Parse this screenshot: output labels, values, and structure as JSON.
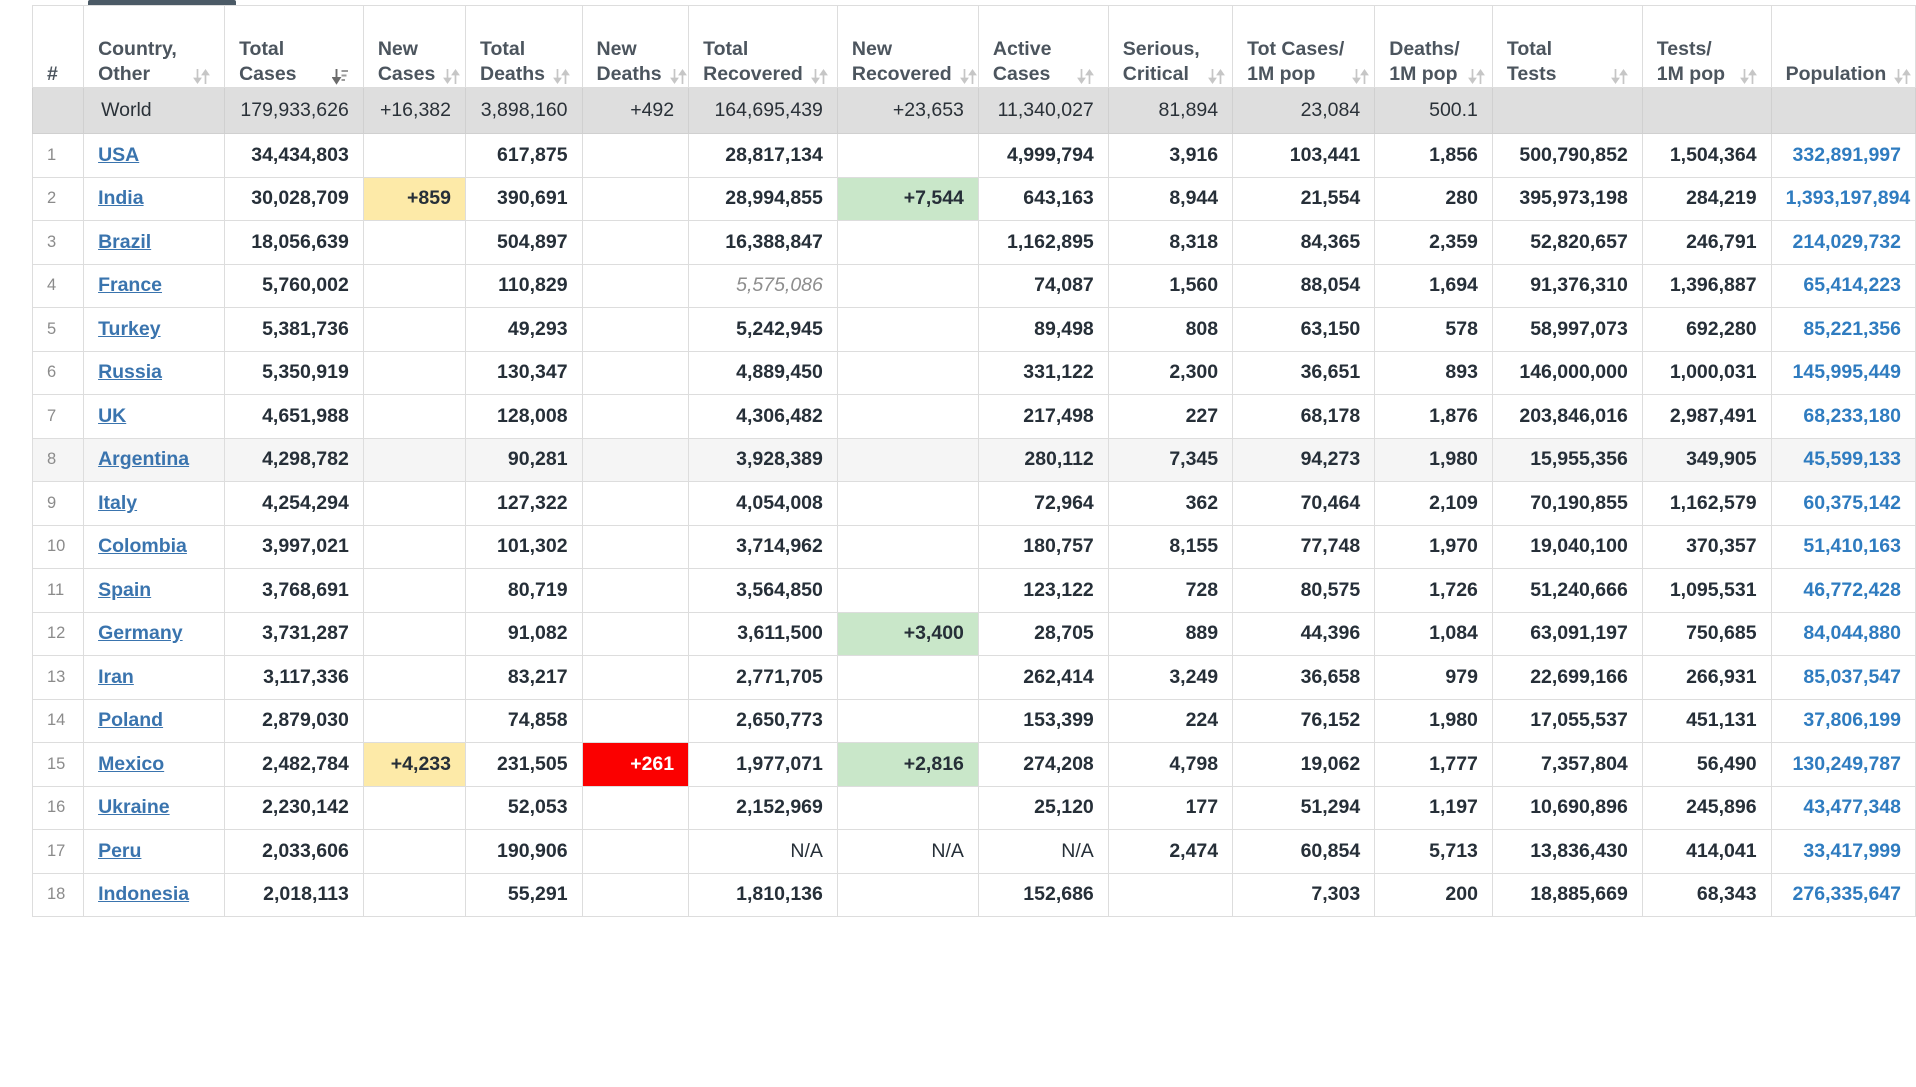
{
  "table": {
    "columns": [
      {
        "label": "#",
        "sortable": false,
        "sort_state": "none"
      },
      {
        "label": "Country,\nOther",
        "line1": "Country,",
        "line2": "Other",
        "sortable": true,
        "sort_state": "none"
      },
      {
        "label": "Total Cases",
        "line1": "Total",
        "line2": "Cases",
        "sortable": true,
        "sort_state": "desc"
      },
      {
        "label": "New Cases",
        "line1": "New",
        "line2": "Cases",
        "sortable": true,
        "sort_state": "none"
      },
      {
        "label": "Total Deaths",
        "line1": "Total",
        "line2": "Deaths",
        "sortable": true,
        "sort_state": "none"
      },
      {
        "label": "New Deaths",
        "line1": "New",
        "line2": "Deaths",
        "sortable": true,
        "sort_state": "none"
      },
      {
        "label": "Total Recovered",
        "line1": "Total",
        "line2": "Recovered",
        "sortable": true,
        "sort_state": "none"
      },
      {
        "label": "New Recovered",
        "line1": "New",
        "line2": "Recovered",
        "sortable": true,
        "sort_state": "none"
      },
      {
        "label": "Active Cases",
        "line1": "Active",
        "line2": "Cases",
        "sortable": true,
        "sort_state": "none"
      },
      {
        "label": "Serious, Critical",
        "line1": "Serious,",
        "line2": "Critical",
        "sortable": true,
        "sort_state": "none"
      },
      {
        "label": "Tot Cases/ 1M pop",
        "line1": "Tot Cases/",
        "line2": "1M pop",
        "sortable": true,
        "sort_state": "none"
      },
      {
        "label": "Deaths/ 1M pop",
        "line1": "Deaths/",
        "line2": "1M pop",
        "sortable": true,
        "sort_state": "none"
      },
      {
        "label": "Total Tests",
        "line1": "Total",
        "line2": "Tests",
        "sortable": true,
        "sort_state": "none"
      },
      {
        "label": "Tests/ 1M pop",
        "line1": "Tests/",
        "line2": "1M pop",
        "sortable": true,
        "sort_state": "none"
      },
      {
        "label": "Population",
        "line1": "",
        "line2": "Population",
        "sortable": true,
        "sort_state": "none"
      }
    ],
    "world_row": {
      "rank": "",
      "country": "World",
      "total_cases": "179,933,626",
      "new_cases": "+16,382",
      "total_deaths": "3,898,160",
      "new_deaths": "+492",
      "total_recovered": "164,695,439",
      "new_recovered": "+23,653",
      "active_cases": "11,340,027",
      "serious_critical": "81,894",
      "tot_cases_1m": "23,084",
      "deaths_1m": "500.1",
      "total_tests": "",
      "tests_1m": "",
      "population": ""
    },
    "rows": [
      {
        "rank": "1",
        "country": "USA",
        "total_cases": "34,434,803",
        "new_cases": "",
        "total_deaths": "617,875",
        "new_deaths": "",
        "total_recovered": "28,817,134",
        "new_recovered": "",
        "active_cases": "4,999,794",
        "serious_critical": "3,916",
        "tot_cases_1m": "103,441",
        "deaths_1m": "1,856",
        "total_tests": "500,790,852",
        "tests_1m": "1,504,364",
        "population": "332,891,997",
        "highlight_row": false,
        "hl_new_cases": "",
        "hl_new_deaths": "",
        "hl_new_recovered": "",
        "recovered_italic": false
      },
      {
        "rank": "2",
        "country": "India",
        "total_cases": "30,028,709",
        "new_cases": "+859",
        "total_deaths": "390,691",
        "new_deaths": "",
        "total_recovered": "28,994,855",
        "new_recovered": "+7,544",
        "active_cases": "643,163",
        "serious_critical": "8,944",
        "tot_cases_1m": "21,554",
        "deaths_1m": "280",
        "total_tests": "395,973,198",
        "tests_1m": "284,219",
        "population": "1,393,197,894",
        "highlight_row": false,
        "hl_new_cases": "yellow",
        "hl_new_deaths": "",
        "hl_new_recovered": "green",
        "recovered_italic": false
      },
      {
        "rank": "3",
        "country": "Brazil",
        "total_cases": "18,056,639",
        "new_cases": "",
        "total_deaths": "504,897",
        "new_deaths": "",
        "total_recovered": "16,388,847",
        "new_recovered": "",
        "active_cases": "1,162,895",
        "serious_critical": "8,318",
        "tot_cases_1m": "84,365",
        "deaths_1m": "2,359",
        "total_tests": "52,820,657",
        "tests_1m": "246,791",
        "population": "214,029,732",
        "highlight_row": false,
        "hl_new_cases": "",
        "hl_new_deaths": "",
        "hl_new_recovered": "",
        "recovered_italic": false
      },
      {
        "rank": "4",
        "country": "France",
        "total_cases": "5,760,002",
        "new_cases": "",
        "total_deaths": "110,829",
        "new_deaths": "",
        "total_recovered": "5,575,086",
        "new_recovered": "",
        "active_cases": "74,087",
        "serious_critical": "1,560",
        "tot_cases_1m": "88,054",
        "deaths_1m": "1,694",
        "total_tests": "91,376,310",
        "tests_1m": "1,396,887",
        "population": "65,414,223",
        "highlight_row": false,
        "hl_new_cases": "",
        "hl_new_deaths": "",
        "hl_new_recovered": "",
        "recovered_italic": true
      },
      {
        "rank": "5",
        "country": "Turkey",
        "total_cases": "5,381,736",
        "new_cases": "",
        "total_deaths": "49,293",
        "new_deaths": "",
        "total_recovered": "5,242,945",
        "new_recovered": "",
        "active_cases": "89,498",
        "serious_critical": "808",
        "tot_cases_1m": "63,150",
        "deaths_1m": "578",
        "total_tests": "58,997,073",
        "tests_1m": "692,280",
        "population": "85,221,356",
        "highlight_row": false,
        "hl_new_cases": "",
        "hl_new_deaths": "",
        "hl_new_recovered": "",
        "recovered_italic": false
      },
      {
        "rank": "6",
        "country": "Russia",
        "total_cases": "5,350,919",
        "new_cases": "",
        "total_deaths": "130,347",
        "new_deaths": "",
        "total_recovered": "4,889,450",
        "new_recovered": "",
        "active_cases": "331,122",
        "serious_critical": "2,300",
        "tot_cases_1m": "36,651",
        "deaths_1m": "893",
        "total_tests": "146,000,000",
        "tests_1m": "1,000,031",
        "population": "145,995,449",
        "highlight_row": false,
        "hl_new_cases": "",
        "hl_new_deaths": "",
        "hl_new_recovered": "",
        "recovered_italic": false
      },
      {
        "rank": "7",
        "country": "UK",
        "total_cases": "4,651,988",
        "new_cases": "",
        "total_deaths": "128,008",
        "new_deaths": "",
        "total_recovered": "4,306,482",
        "new_recovered": "",
        "active_cases": "217,498",
        "serious_critical": "227",
        "tot_cases_1m": "68,178",
        "deaths_1m": "1,876",
        "total_tests": "203,846,016",
        "tests_1m": "2,987,491",
        "population": "68,233,180",
        "highlight_row": false,
        "hl_new_cases": "",
        "hl_new_deaths": "",
        "hl_new_recovered": "",
        "recovered_italic": false
      },
      {
        "rank": "8",
        "country": "Argentina",
        "total_cases": "4,298,782",
        "new_cases": "",
        "total_deaths": "90,281",
        "new_deaths": "",
        "total_recovered": "3,928,389",
        "new_recovered": "",
        "active_cases": "280,112",
        "serious_critical": "7,345",
        "tot_cases_1m": "94,273",
        "deaths_1m": "1,980",
        "total_tests": "15,955,356",
        "tests_1m": "349,905",
        "population": "45,599,133",
        "highlight_row": true,
        "hl_new_cases": "",
        "hl_new_deaths": "",
        "hl_new_recovered": "",
        "recovered_italic": false
      },
      {
        "rank": "9",
        "country": "Italy",
        "total_cases": "4,254,294",
        "new_cases": "",
        "total_deaths": "127,322",
        "new_deaths": "",
        "total_recovered": "4,054,008",
        "new_recovered": "",
        "active_cases": "72,964",
        "serious_critical": "362",
        "tot_cases_1m": "70,464",
        "deaths_1m": "2,109",
        "total_tests": "70,190,855",
        "tests_1m": "1,162,579",
        "population": "60,375,142",
        "highlight_row": false,
        "hl_new_cases": "",
        "hl_new_deaths": "",
        "hl_new_recovered": "",
        "recovered_italic": false
      },
      {
        "rank": "10",
        "country": "Colombia",
        "total_cases": "3,997,021",
        "new_cases": "",
        "total_deaths": "101,302",
        "new_deaths": "",
        "total_recovered": "3,714,962",
        "new_recovered": "",
        "active_cases": "180,757",
        "serious_critical": "8,155",
        "tot_cases_1m": "77,748",
        "deaths_1m": "1,970",
        "total_tests": "19,040,100",
        "tests_1m": "370,357",
        "population": "51,410,163",
        "highlight_row": false,
        "hl_new_cases": "",
        "hl_new_deaths": "",
        "hl_new_recovered": "",
        "recovered_italic": false
      },
      {
        "rank": "11",
        "country": "Spain",
        "total_cases": "3,768,691",
        "new_cases": "",
        "total_deaths": "80,719",
        "new_deaths": "",
        "total_recovered": "3,564,850",
        "new_recovered": "",
        "active_cases": "123,122",
        "serious_critical": "728",
        "tot_cases_1m": "80,575",
        "deaths_1m": "1,726",
        "total_tests": "51,240,666",
        "tests_1m": "1,095,531",
        "population": "46,772,428",
        "highlight_row": false,
        "hl_new_cases": "",
        "hl_new_deaths": "",
        "hl_new_recovered": "",
        "recovered_italic": false
      },
      {
        "rank": "12",
        "country": "Germany",
        "total_cases": "3,731,287",
        "new_cases": "",
        "total_deaths": "91,082",
        "new_deaths": "",
        "total_recovered": "3,611,500",
        "new_recovered": "+3,400",
        "active_cases": "28,705",
        "serious_critical": "889",
        "tot_cases_1m": "44,396",
        "deaths_1m": "1,084",
        "total_tests": "63,091,197",
        "tests_1m": "750,685",
        "population": "84,044,880",
        "highlight_row": false,
        "hl_new_cases": "",
        "hl_new_deaths": "",
        "hl_new_recovered": "green",
        "recovered_italic": false
      },
      {
        "rank": "13",
        "country": "Iran",
        "total_cases": "3,117,336",
        "new_cases": "",
        "total_deaths": "83,217",
        "new_deaths": "",
        "total_recovered": "2,771,705",
        "new_recovered": "",
        "active_cases": "262,414",
        "serious_critical": "3,249",
        "tot_cases_1m": "36,658",
        "deaths_1m": "979",
        "total_tests": "22,699,166",
        "tests_1m": "266,931",
        "population": "85,037,547",
        "highlight_row": false,
        "hl_new_cases": "",
        "hl_new_deaths": "",
        "hl_new_recovered": "",
        "recovered_italic": false
      },
      {
        "rank": "14",
        "country": "Poland",
        "total_cases": "2,879,030",
        "new_cases": "",
        "total_deaths": "74,858",
        "new_deaths": "",
        "total_recovered": "2,650,773",
        "new_recovered": "",
        "active_cases": "153,399",
        "serious_critical": "224",
        "tot_cases_1m": "76,152",
        "deaths_1m": "1,980",
        "total_tests": "17,055,537",
        "tests_1m": "451,131",
        "population": "37,806,199",
        "highlight_row": false,
        "hl_new_cases": "",
        "hl_new_deaths": "",
        "hl_new_recovered": "",
        "recovered_italic": false
      },
      {
        "rank": "15",
        "country": "Mexico",
        "total_cases": "2,482,784",
        "new_cases": "+4,233",
        "total_deaths": "231,505",
        "new_deaths": "+261",
        "total_recovered": "1,977,071",
        "new_recovered": "+2,816",
        "active_cases": "274,208",
        "serious_critical": "4,798",
        "tot_cases_1m": "19,062",
        "deaths_1m": "1,777",
        "total_tests": "7,357,804",
        "tests_1m": "56,490",
        "population": "130,249,787",
        "highlight_row": false,
        "hl_new_cases": "yellow",
        "hl_new_deaths": "red",
        "hl_new_recovered": "green",
        "recovered_italic": false
      },
      {
        "rank": "16",
        "country": "Ukraine",
        "total_cases": "2,230,142",
        "new_cases": "",
        "total_deaths": "52,053",
        "new_deaths": "",
        "total_recovered": "2,152,969",
        "new_recovered": "",
        "active_cases": "25,120",
        "serious_critical": "177",
        "tot_cases_1m": "51,294",
        "deaths_1m": "1,197",
        "total_tests": "10,690,896",
        "tests_1m": "245,896",
        "population": "43,477,348",
        "highlight_row": false,
        "hl_new_cases": "",
        "hl_new_deaths": "",
        "hl_new_recovered": "",
        "recovered_italic": false
      },
      {
        "rank": "17",
        "country": "Peru",
        "total_cases": "2,033,606",
        "new_cases": "",
        "total_deaths": "190,906",
        "new_deaths": "",
        "total_recovered": "N/A",
        "new_recovered": "N/A",
        "active_cases": "N/A",
        "serious_critical": "2,474",
        "tot_cases_1m": "60,854",
        "deaths_1m": "5,713",
        "total_tests": "13,836,430",
        "tests_1m": "414,041",
        "population": "33,417,999",
        "highlight_row": false,
        "hl_new_cases": "",
        "hl_new_deaths": "",
        "hl_new_recovered": "",
        "recovered_italic": false
      },
      {
        "rank": "18",
        "country": "Indonesia",
        "total_cases": "2,018,113",
        "new_cases": "",
        "total_deaths": "55,291",
        "new_deaths": "",
        "total_recovered": "1,810,136",
        "new_recovered": "",
        "active_cases": "152,686",
        "serious_critical": "",
        "tot_cases_1m": "7,303",
        "deaths_1m": "200",
        "total_tests": "18,885,669",
        "tests_1m": "68,343",
        "population": "276,335,647",
        "highlight_row": false,
        "hl_new_cases": "",
        "hl_new_deaths": "",
        "hl_new_recovered": "",
        "recovered_italic": false
      }
    ]
  },
  "colors": {
    "link": "#3a74ae",
    "population_link": "#2f7cc0",
    "highlight_yellow": "#fdeaa8",
    "highlight_green": "#c9e7c9",
    "highlight_red": "#fb0000",
    "world_row_bg": "#dedede",
    "hover_row_bg": "#f5f5f5"
  }
}
